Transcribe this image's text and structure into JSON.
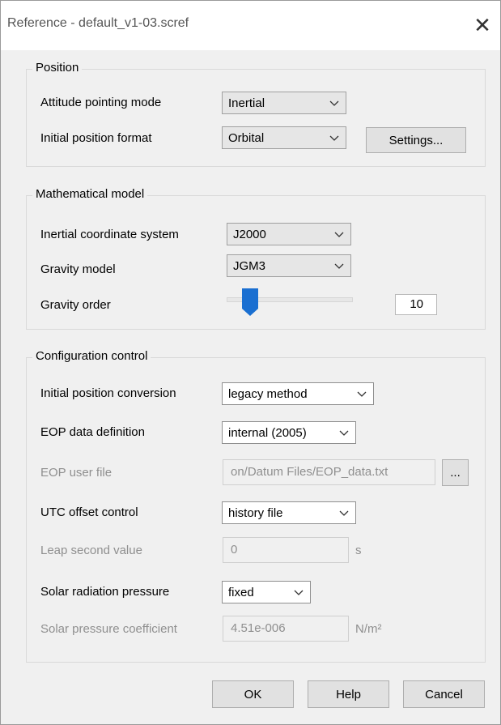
{
  "window": {
    "title": "Reference - default_v1-03.scref",
    "close_glyph": "✕"
  },
  "position": {
    "title": "Position",
    "attitude_label": "Attitude pointing mode",
    "attitude_value": "Inertial",
    "format_label": "Initial position format",
    "format_value": "Orbital",
    "settings_button": "Settings..."
  },
  "math_model": {
    "title": "Mathematical model",
    "inertial_label": "Inertial coordinate system",
    "inertial_value": "J2000",
    "gravity_model_label": "Gravity model",
    "gravity_model_value": "JGM3",
    "gravity_order_label": "Gravity order",
    "gravity_order_value": "10"
  },
  "config": {
    "title": "Configuration control",
    "conversion_label": "Initial position conversion",
    "conversion_value": "legacy method",
    "eop_def_label": "EOP data definition",
    "eop_def_value": "internal (2005)",
    "eop_file_label": "EOP user file",
    "eop_file_value": "on/Datum Files/EOP_data.txt",
    "browse_button": "...",
    "utc_label": "UTC offset control",
    "utc_value": "history file",
    "leap_label": "Leap second value",
    "leap_value": "0",
    "leap_unit": "s",
    "srp_label": "Solar radiation pressure",
    "srp_value": "fixed",
    "coef_label": "Solar pressure coefficient",
    "coef_value": "4.51e-006",
    "coef_unit": "N/m²"
  },
  "buttons": {
    "ok": "OK",
    "help": "Help",
    "cancel": "Cancel"
  },
  "colors": {
    "accent": "#1a6fd1",
    "window_bg": "#f0f0f0",
    "disabled_text": "#8f8f8f"
  }
}
